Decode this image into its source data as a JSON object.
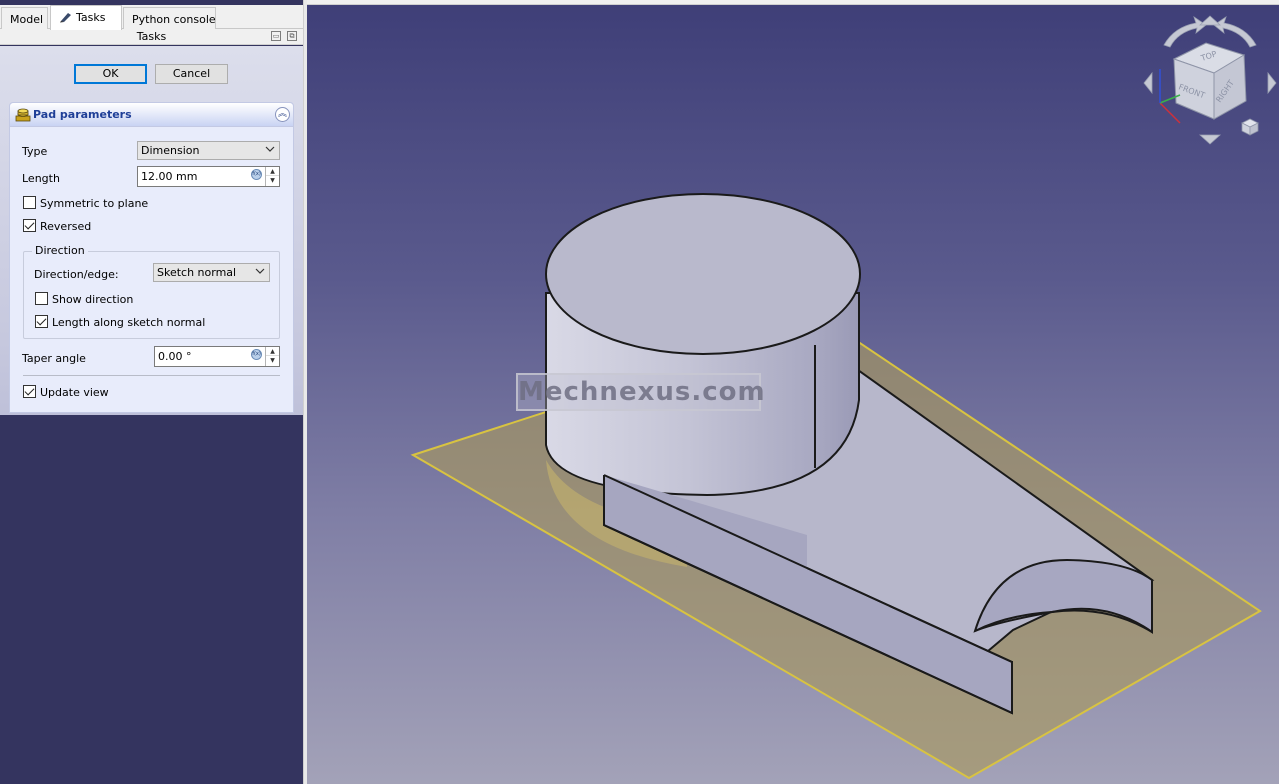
{
  "tabs": [
    {
      "label": "Model",
      "active": false
    },
    {
      "label": "Tasks",
      "active": true,
      "icon": "pencil-icon"
    },
    {
      "label": "Python console",
      "active": false
    }
  ],
  "tasks_header": {
    "title": "Tasks"
  },
  "dialog_buttons": {
    "ok_label": "OK",
    "cancel_label": "Cancel"
  },
  "pad_panel": {
    "title": "Pad parameters",
    "icon": "pad-icon",
    "type_label": "Type",
    "type_value": "Dimension",
    "length_label": "Length",
    "length_value": "12.00 mm",
    "symmetric_label": "Symmetric to plane",
    "symmetric_checked": false,
    "reversed_label": "Reversed",
    "reversed_checked": true,
    "direction": {
      "title": "Direction",
      "edge_label": "Direction/edge:",
      "edge_value": "Sketch normal",
      "show_direction_label": "Show direction",
      "show_direction_checked": false,
      "length_along_label": "Length along sketch normal",
      "length_along_checked": true
    },
    "taper_label": "Taper angle",
    "taper_value": "0.00 °",
    "update_view_label": "Update view",
    "update_view_checked": true
  },
  "viewport": {
    "watermark": "Mechnexus.com",
    "navcube": {
      "top": "TOP",
      "front": "FRONT",
      "right": "RIGHT"
    }
  },
  "colors": {
    "panel_bg": "#34345f",
    "viewport_top": "#3f3f78",
    "viewport_bottom": "#a3a2b8",
    "sketch_plane": "#a8985f",
    "solid_face": "#b8b8cc",
    "accent": "#0078d7",
    "panel_title": "#1f3f97"
  }
}
